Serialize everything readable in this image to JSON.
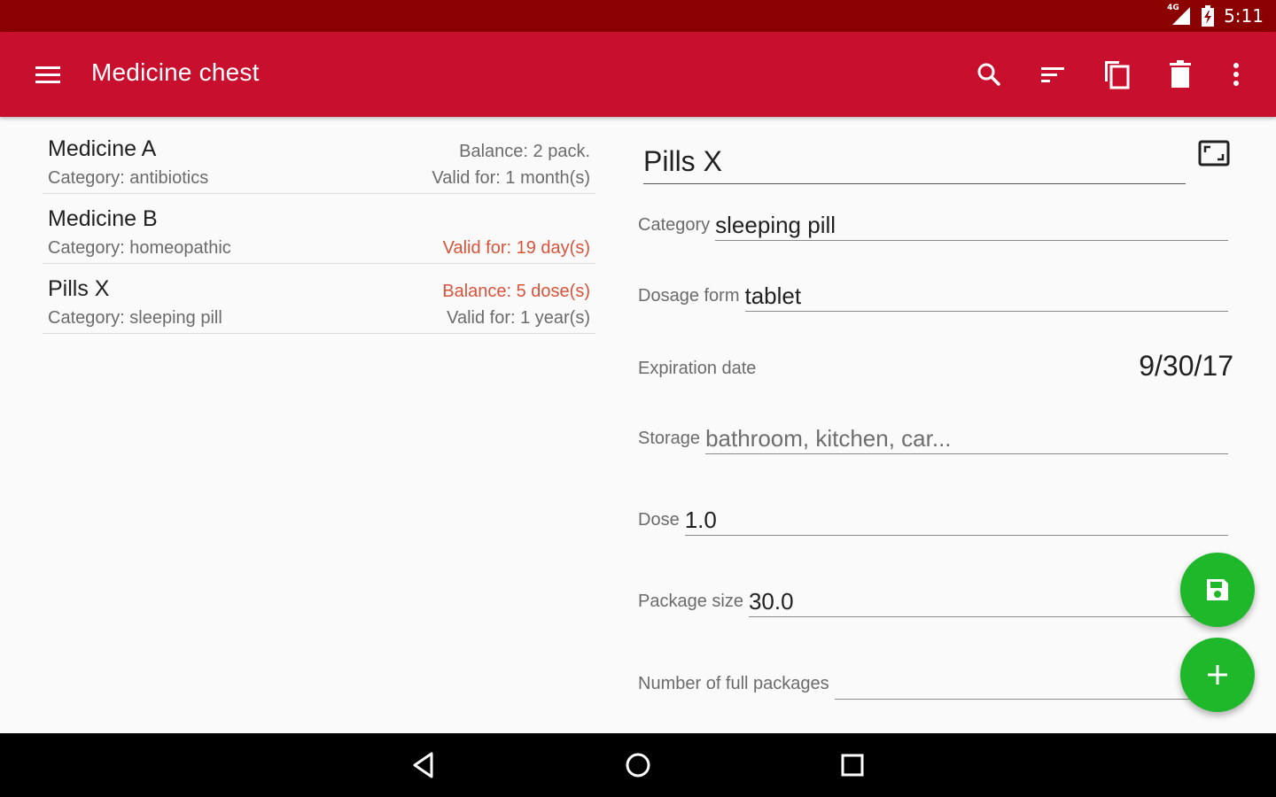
{
  "status_bar": {
    "network": "4G",
    "time": "5:11"
  },
  "app_bar": {
    "title": "Medicine chest"
  },
  "medicines": [
    {
      "name": "Medicine A",
      "category": "Category: antibiotics",
      "balance": "Balance: 2 pack.",
      "valid": "Valid for: 1 month(s)",
      "balance_warn": false,
      "valid_warn": false
    },
    {
      "name": "Medicine B",
      "category": "Category: homeopathic",
      "balance": "",
      "valid": "Valid for: 19 day(s)",
      "balance_warn": false,
      "valid_warn": true
    },
    {
      "name": "Pills X",
      "category": "Category: sleeping pill",
      "balance": "Balance: 5 dose(s)",
      "valid": "Valid for: 1 year(s)",
      "balance_warn": true,
      "valid_warn": false
    }
  ],
  "detail": {
    "name": "Pills X",
    "category_label": "Category",
    "category_value": "sleeping pill",
    "dosage_label": "Dosage form",
    "dosage_value": "tablet",
    "expiration_label": "Expiration date",
    "expiration_value": "9/30/17",
    "storage_label": "Storage",
    "storage_placeholder": "bathroom, kitchen, car...",
    "dose_label": "Dose",
    "dose_value": "1.0",
    "package_label": "Package size",
    "package_value": "30.0",
    "full_packages_label": "Number of full packages",
    "full_packages_value": ""
  },
  "colors": {
    "status_bar": "#8b0000",
    "app_bar": "#c8102e",
    "fab": "#1fb82a",
    "warning_text": "#d9533a"
  },
  "icons": {
    "app_bar": [
      "menu-icon",
      "search-icon",
      "sort-icon",
      "copy-icon",
      "delete-icon",
      "more-vert-icon"
    ],
    "detail": [
      "expand-icon"
    ],
    "fabs": [
      "save-icon",
      "add-icon"
    ],
    "nav": [
      "back-icon",
      "home-icon",
      "recents-icon"
    ]
  }
}
